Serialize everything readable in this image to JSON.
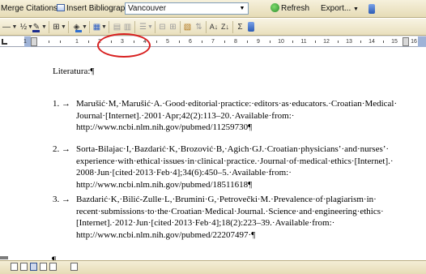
{
  "toolbar_top": {
    "merge_citations": "Merge Citations",
    "insert_bibliography": "Insert Bibliography",
    "style_value": "Vancouver",
    "refresh": "Refresh",
    "export": "Export..."
  },
  "toolbar_format": {
    "line_weight": "½",
    "font_color_letter": "A"
  },
  "ruler": {
    "labels": [
      "1",
      "1",
      "2",
      "3",
      "4",
      "5",
      "6",
      "7",
      "8",
      "9",
      "10",
      "11",
      "12",
      "13",
      "14",
      "15",
      "16"
    ]
  },
  "document": {
    "heading": "Literatura:¶",
    "references": [
      {
        "number": "1.",
        "lines": [
          "Marušić·M,·Marušić·A.·Good·editorial·practice:·editors·as·educators.·Croatian·Medical·",
          "Journal·[Internet].·2001·Apr;42(2):113–20.·Available·from:·",
          "http://www.ncbi.nlm.nih.gov/pubmed/11259730¶"
        ]
      },
      {
        "number": "2.",
        "lines": [
          "Sorta-Bilajac·I,·Bazdarić·K,·Brozović·B,·Agich·GJ.·Croatian·physicians’·and·nurses’·",
          "experience·with·ethical·issues·in·clinical·practice.·Journal·of·medical·ethics·[Internet].·",
          "2008·Jun·[cited·2013·Feb·4];34(6):450–5.·Available·from:·",
          "http://www.ncbi.nlm.nih.gov/pubmed/18511618¶"
        ]
      },
      {
        "number": "3.",
        "lines": [
          "Bazdarić·K,·Bilić-Zulle·L,·Brumini·G,·Petrovečki·M.·Prevalence·of·plagiarism·in·",
          "recent·submissions·to·the·Croatian·Medical·Journal.·Science·and·engineering·ethics·",
          "[Internet].·2012·Jun·[cited·2013·Feb·4];18(2):223–39.·Available·from:·",
          "http://www.ncbi.nlm.nih.gov/pubmed/22207497·¶"
        ]
      }
    ],
    "end_mark": "¶",
    "arrow": "→"
  },
  "colors": {
    "annotation_circle": "#d81f1f",
    "toolbar_bg": "#efe7c8"
  }
}
